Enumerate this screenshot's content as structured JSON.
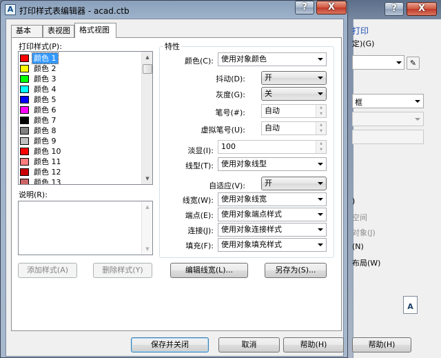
{
  "main": {
    "title": "打印样式表编辑器 - acad.ctb",
    "app_icon": "A",
    "help_btn": "?",
    "close_btn": "X",
    "tabs": [
      {
        "label": "基本",
        "active": false
      },
      {
        "label": "表视图",
        "active": false
      },
      {
        "label": "格式视图",
        "active": true
      }
    ],
    "styles_label": "打印样式(P):",
    "styles": [
      {
        "label": "颜色 1",
        "color": "#ff0000",
        "selected": true
      },
      {
        "label": "颜色 2",
        "color": "#ffff00"
      },
      {
        "label": "颜色 3",
        "color": "#00ff00"
      },
      {
        "label": "颜色 4",
        "color": "#00ffff"
      },
      {
        "label": "颜色 5",
        "color": "#0000ff"
      },
      {
        "label": "颜色 6",
        "color": "#ff00ff"
      },
      {
        "label": "颜色 7",
        "color": "#000000"
      },
      {
        "label": "颜色 8",
        "color": "#808080"
      },
      {
        "label": "颜色 9",
        "color": "#c0c0c0"
      },
      {
        "label": "颜色 10",
        "color": "#ff0000"
      },
      {
        "label": "颜色 11",
        "color": "#ff7f7f"
      },
      {
        "label": "颜色 12",
        "color": "#cc0000"
      },
      {
        "label": "颜色 13",
        "color": "#cc6666"
      }
    ],
    "desc_label": "说明(R):",
    "add_style": "添加样式(A)",
    "delete_style": "删除样式(Y)",
    "props": {
      "group_title": "特性",
      "color_label": "颜色(C):",
      "color_value": "使用对象颜色",
      "dither_label": "抖动(D):",
      "dither_value": "开",
      "gray_label": "灰度(G):",
      "gray_value": "关",
      "pen_label": "笔号(#):",
      "pen_value": "自动",
      "vpen_label": "虚拟笔号(U):",
      "vpen_value": "自动",
      "screen_label": "淡显(I):",
      "screen_value": "100",
      "ltype_label": "线型(T):",
      "ltype_value": "使用对象线型",
      "adaptive_label": "自适应(V):",
      "adaptive_value": "开",
      "lweight_label": "线宽(W):",
      "lweight_value": "使用对象线宽",
      "endcap_label": "端点(E):",
      "endcap_value": "使用对象端点样式",
      "join_label": "连接(J):",
      "join_value": "使用对象连接样式",
      "fill_label": "填充(F):",
      "fill_value": "使用对象填充样式"
    },
    "edit_lineweights": "编辑线宽(L)...",
    "save_as": "另存为(S)...",
    "save_close": "保存并关闭",
    "cancel": "取消",
    "help": "帮助(H)"
  },
  "background": {
    "help_btn": "?",
    "close_btn": "X",
    "link_text": "打印",
    "row1": "定)(G)",
    "dropdown_text": "框",
    "opt_a": ")",
    "opt_b": "空间",
    "opt_c": "对象(J)",
    "opt_d": "(N)",
    "opt_e": "布局(W)",
    "help": "帮助(H)",
    "doc_icon": "A"
  }
}
